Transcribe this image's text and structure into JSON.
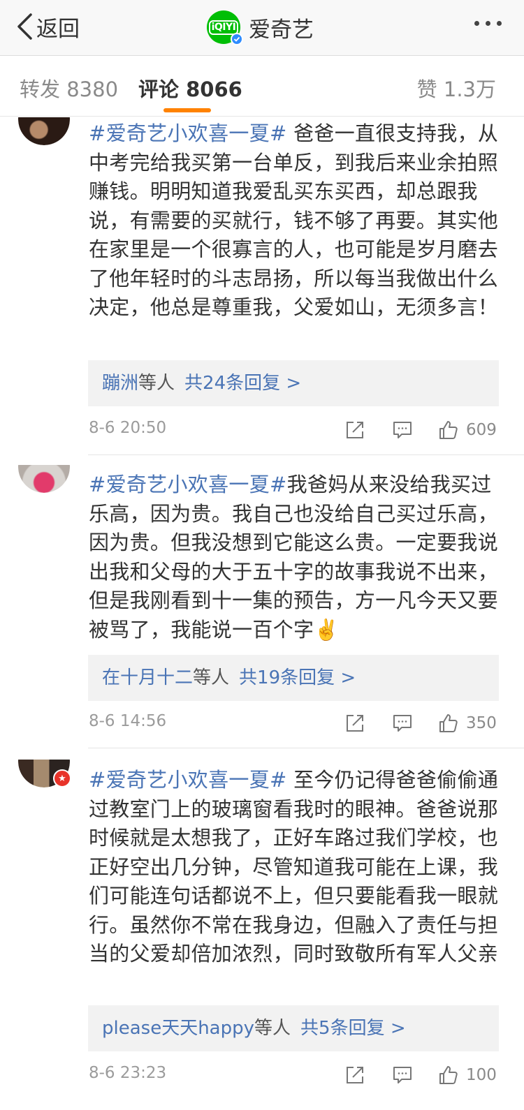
{
  "nav": {
    "back_label": "返回",
    "title": "爱奇艺",
    "logo_text": "iQIYI",
    "back_icon": "chevron-left-icon",
    "more_icon": "more-dots-icon"
  },
  "tabs": {
    "repost": "转发 8380",
    "comment": "评论 8066",
    "like": "赞 1.3万",
    "active_color": "#ff8200"
  },
  "colors": {
    "link": "#4a74b5",
    "brand_green": "#00be06",
    "verified_blue": "#2f8cff"
  },
  "comments": [
    {
      "topic": "#爱奇艺小欢喜一夏#",
      "body": " 爸爸一直很支持我，从中考完给我买第一台单反，到我后来业余拍照赚钱。明明知道我爱乱买东买西，却总跟我说，有需要的买就行，钱不够了再要。其实他在家里是一个很寡言的人，也可能是岁月磨去了他年轻时的斗志昂扬，所以每当我做出什么决定，他总是尊重我，父爱如山，无须多言！",
      "reply_name": "蹦洲",
      "reply_suffix": "等人",
      "reply_count": "共24条回复 >",
      "time": "8-6 20:50",
      "likes": "609"
    },
    {
      "topic": "#爱奇艺小欢喜一夏#",
      "body": "我爸妈从来没给我买过乐高，因为贵。我自己也没给自己买过乐高，因为贵。但我没想到它能这么贵。一定要我说出我和父母的大于五十字的故事我说不出来，但是我刚看到十一集的预告，方一凡今天又要被骂了，我能说一百个字✌️",
      "reply_name": "在十月十二",
      "reply_suffix": "等人",
      "reply_count": "共19条回复 >",
      "time": "8-6 14:56",
      "likes": "350"
    },
    {
      "topic": "#爱奇艺小欢喜一夏#",
      "body": " 至今仍记得爸爸偷偷通过教室门上的玻璃窗看我时的眼神。爸爸说那时候就是太想我了，正好车路过我们学校，也正好空出几分钟，尽管知道我可能在上课，我们可能连句话都说不上，但只要能看我一眼就行。虽然你不常在我身边，但融入了责任与担当的父爱却倍加浓烈，同时致敬所有军人父亲",
      "reply_name": "please天天happy",
      "reply_suffix": "等人",
      "reply_count": "共5条回复 >",
      "time": "8-6 23:23",
      "likes": "100"
    }
  ]
}
